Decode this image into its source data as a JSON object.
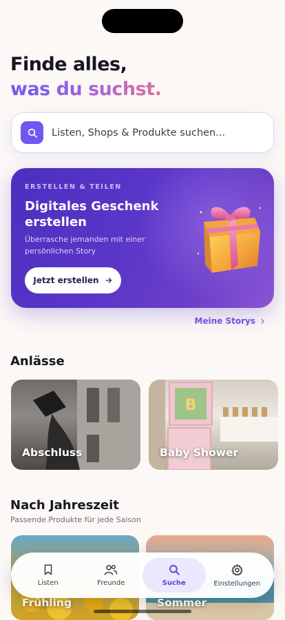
{
  "headline": {
    "line1": "Finde alles,",
    "line2": "was du suchst."
  },
  "search": {
    "placeholder": "Listen, Shops & Produkte suchen...",
    "icon": "search-icon"
  },
  "promo": {
    "kicker": "ERSTELLEN & TEILEN",
    "title": "Digitales Geschenk erstellen",
    "description": "Überrasche jemanden mit einer persönlichen Story",
    "button_label": "Jetzt erstellen"
  },
  "my_stories_link": "Meine Storys",
  "occasions": {
    "title": "Anlässe",
    "items": [
      {
        "label": "Abschluss"
      },
      {
        "label": "Baby Shower"
      }
    ]
  },
  "seasons": {
    "title": "Nach Jahreszeit",
    "subtitle": "Passende Produkte für jede Saison",
    "items": [
      {
        "label": "Frühling"
      },
      {
        "label": "Sommer"
      }
    ]
  },
  "tabbar": {
    "items": [
      {
        "label": "Listen",
        "icon": "bookmark-icon"
      },
      {
        "label": "Freunde",
        "icon": "friends-icon"
      },
      {
        "label": "Suche",
        "icon": "search-icon",
        "active": true
      },
      {
        "label": "Einstellungen",
        "icon": "gear-icon"
      }
    ]
  },
  "colors": {
    "accent": "#7156ef",
    "promo_bg": "#5a36c8",
    "background": "#fbf8f6"
  }
}
